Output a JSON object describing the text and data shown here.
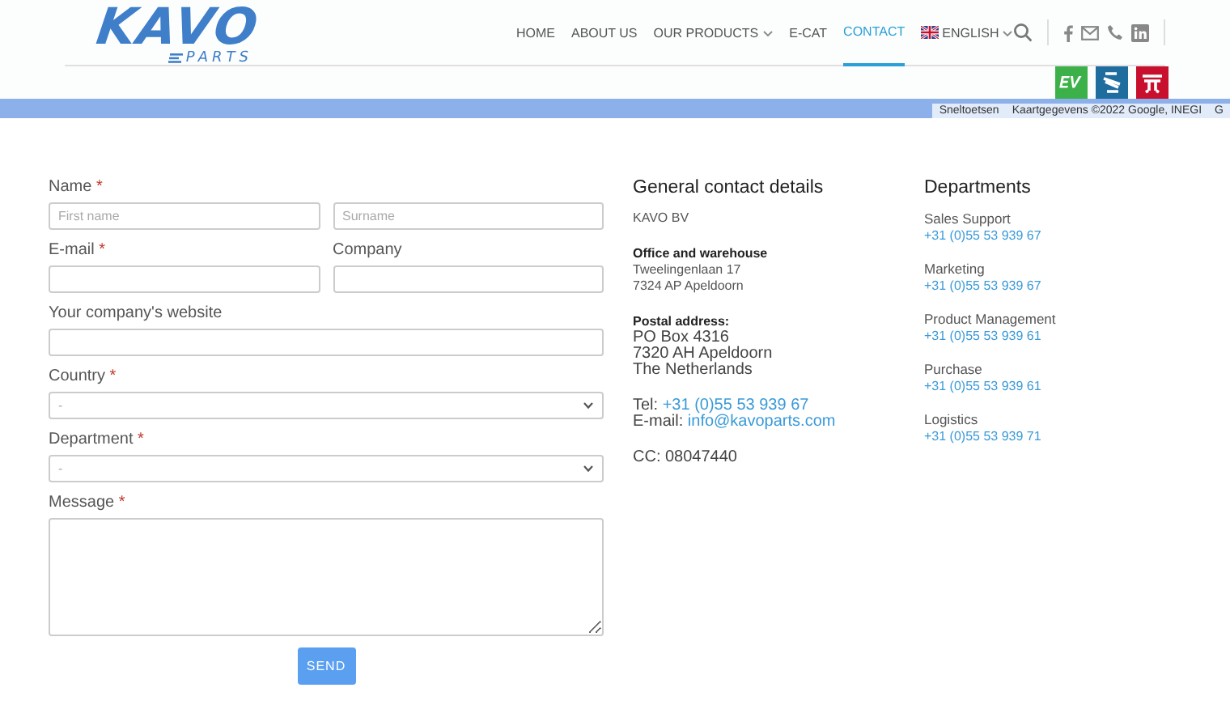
{
  "header": {
    "logo": {
      "brand": "KAVO",
      "sub": "PARTS"
    },
    "nav": [
      {
        "label": "HOME",
        "selected": false,
        "dropdown": false
      },
      {
        "label": "ABOUT US",
        "selected": false,
        "dropdown": false
      },
      {
        "label": "OUR PRODUCTS",
        "selected": false,
        "dropdown": true
      },
      {
        "label": "E-CAT",
        "selected": false,
        "dropdown": false
      },
      {
        "label": "CONTACT",
        "selected": true,
        "dropdown": false
      }
    ],
    "language": {
      "label": "ENGLISH"
    },
    "map_attribution": [
      "Sneltoetsen",
      "Kaartgegevens ©2022 Google, INEGI",
      "G"
    ]
  },
  "form": {
    "rows": [
      {
        "kind": "pair",
        "fields": [
          {
            "label": "Name",
            "marker": "*",
            "placeholder": "First name"
          },
          {
            "placeholder": "Surname"
          }
        ]
      },
      {
        "kind": "pair",
        "fields": [
          {
            "label": "E-mail",
            "marker": "*"
          },
          {
            "label": "Company"
          }
        ]
      },
      {
        "kind": "text",
        "label": "Your company's website"
      },
      {
        "kind": "select",
        "label": "Country",
        "marker": "*",
        "value": "-"
      },
      {
        "kind": "select",
        "label": "Department",
        "marker": "*",
        "value": "-"
      },
      {
        "kind": "textarea",
        "label": "Message",
        "marker": "*"
      }
    ],
    "send": "SEND"
  },
  "contact": {
    "title": "General contact details",
    "company": "KAVO BV",
    "blocks": [
      {
        "kind": "compact",
        "heading": "Office and warehouse",
        "lines": [
          "Tweelingenlaan 17",
          "7324 AP Apeldoorn"
        ]
      },
      {
        "kind": "large",
        "heading": "Postal address:",
        "lines": [
          "PO Box 4316",
          "7320 AH Apeldoorn",
          "The Netherlands"
        ]
      }
    ],
    "tel": {
      "label": "Tel:",
      "value": "+31 (0)55 53 939 67"
    },
    "email": {
      "label": "E-mail:",
      "value": "info@kavoparts.com"
    },
    "cc": "CC: 08047440"
  },
  "departments": {
    "title": "Departments",
    "items": [
      {
        "name": "Sales Support",
        "phone": "+31 (0)55 53 939 67"
      },
      {
        "name": "Marketing",
        "phone": "+31 (0)55 53 939 67"
      },
      {
        "name": "Product Management",
        "phone": "+31 (0)55 53 939 61"
      },
      {
        "name": "Purchase",
        "phone": "+31 (0)55 53 939 61"
      },
      {
        "name": "Logistics",
        "phone": "+31 (0)55 53 939 71"
      }
    ]
  }
}
